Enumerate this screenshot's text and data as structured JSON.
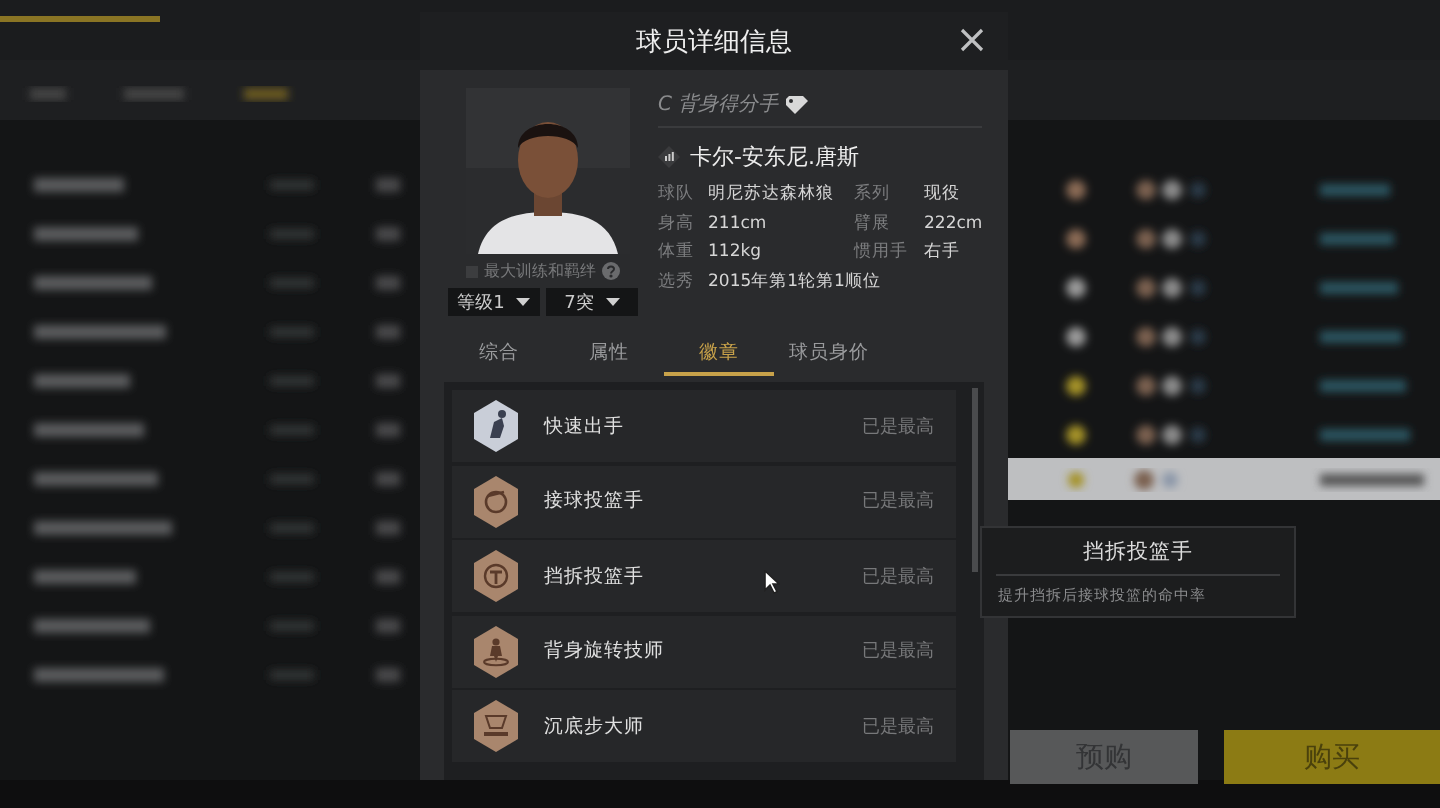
{
  "backdrop": {
    "buttons": [
      {
        "label": "预购",
        "kind": "secondary"
      },
      {
        "label": "购买",
        "kind": "primary"
      }
    ]
  },
  "dialog": {
    "title": "球员详细信息",
    "player": {
      "role": "C 背身得分手",
      "name": "卡尔-安东尼.唐斯",
      "info_rows": [
        [
          {
            "label": "球队",
            "value": "明尼苏达森林狼"
          },
          {
            "label": "系列",
            "value": "现役"
          }
        ],
        [
          {
            "label": "身高",
            "value": "211cm"
          },
          {
            "label": "臂展",
            "value": "222cm"
          }
        ],
        [
          {
            "label": "体重",
            "value": "112kg"
          },
          {
            "label": "惯用手",
            "value": "右手"
          }
        ],
        [
          {
            "label": "选秀",
            "value": "2015年第1轮第1顺位"
          }
        ]
      ]
    },
    "max_training": {
      "label": "最大训练和羁绊",
      "checked": false
    },
    "dropdowns": [
      {
        "value": "等级1"
      },
      {
        "value": "7突"
      }
    ],
    "tabs": [
      {
        "label": "综合",
        "selected": false
      },
      {
        "label": "属性",
        "selected": false
      },
      {
        "label": "徽章",
        "selected": true
      },
      {
        "label": "球员身价",
        "selected": false
      }
    ],
    "badges": [
      {
        "name": "快速出手",
        "status": "已是最高",
        "color": "#c9ced8",
        "kind": "hand"
      },
      {
        "name": "接球投篮手",
        "status": "已是最高",
        "color": "#a9866d",
        "kind": "ball"
      },
      {
        "name": "挡拆投篮手",
        "status": "已是最高",
        "color": "#a9866d",
        "kind": "screen"
      },
      {
        "name": "背身旋转技师",
        "status": "已是最高",
        "color": "#a9866d",
        "kind": "spin"
      },
      {
        "name": "沉底步大师",
        "status": "已是最高",
        "color": "#a9866d",
        "kind": "step"
      }
    ]
  },
  "tooltip": {
    "title": "挡拆投篮手",
    "description": "提升挡拆后接球投篮的命中率"
  }
}
